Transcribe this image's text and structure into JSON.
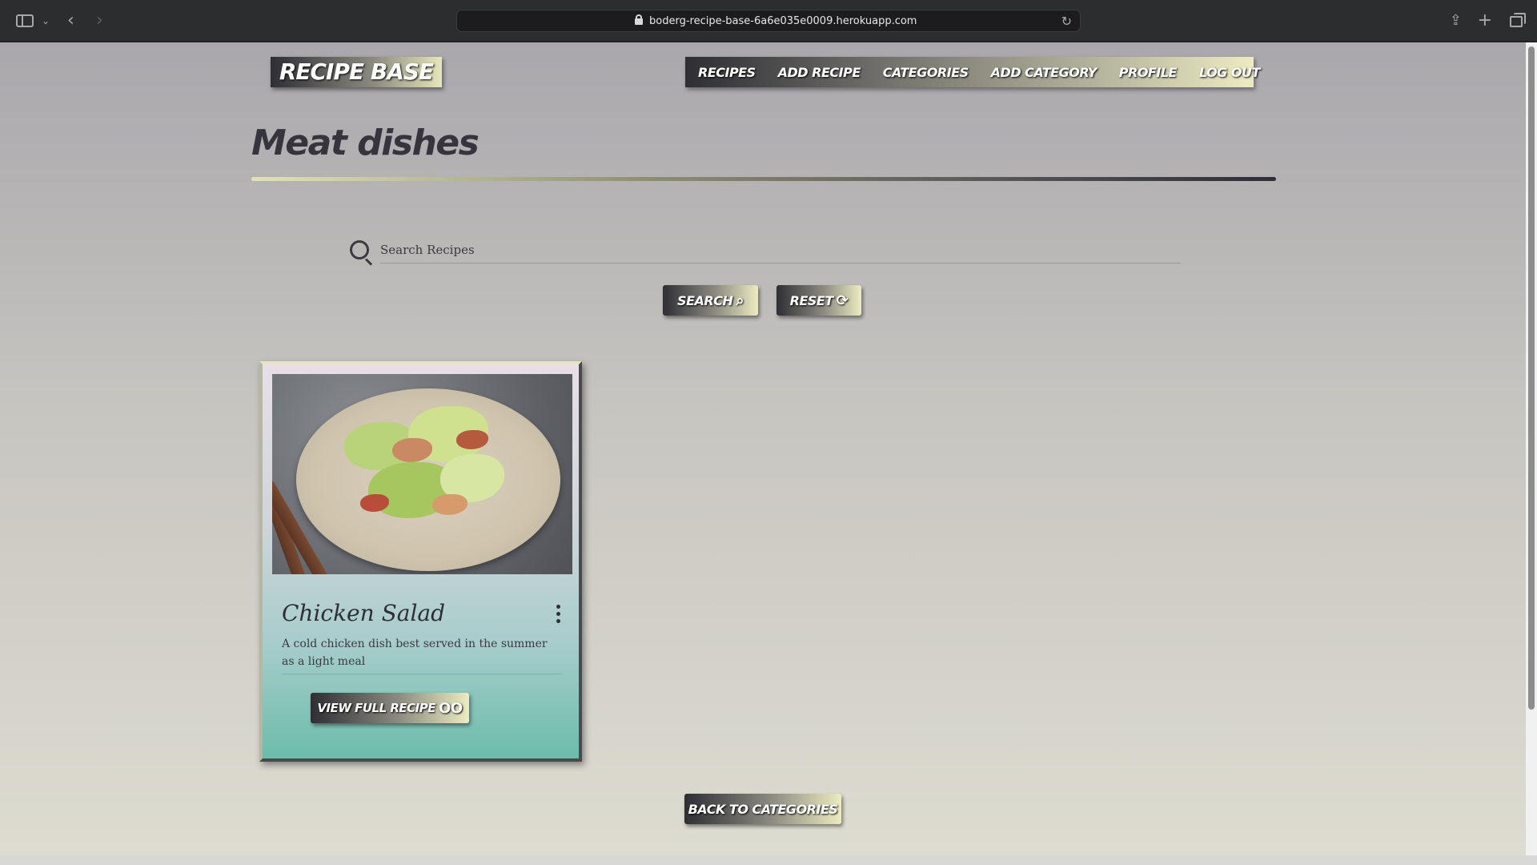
{
  "browser": {
    "url": "boderg-recipe-base-6a6e035e0009.herokuapp.com"
  },
  "site": {
    "logo": "RECIPE BASE",
    "nav": [
      "RECIPES",
      "ADD RECIPE",
      "CATEGORIES",
      "ADD CATEGORY",
      "PROFILE",
      "LOG OUT"
    ]
  },
  "page": {
    "title": "Meat dishes"
  },
  "search": {
    "placeholder": "Search Recipes",
    "search_label": "SEARCH",
    "reset_label": "RESET"
  },
  "recipes": [
    {
      "title": "Chicken Salad",
      "description": "A cold chicken dish best served in the summer as a light meal",
      "button_label": "VIEW FULL RECIPE"
    }
  ],
  "footer": {
    "back_label": "BACK TO CATEGORIES"
  }
}
